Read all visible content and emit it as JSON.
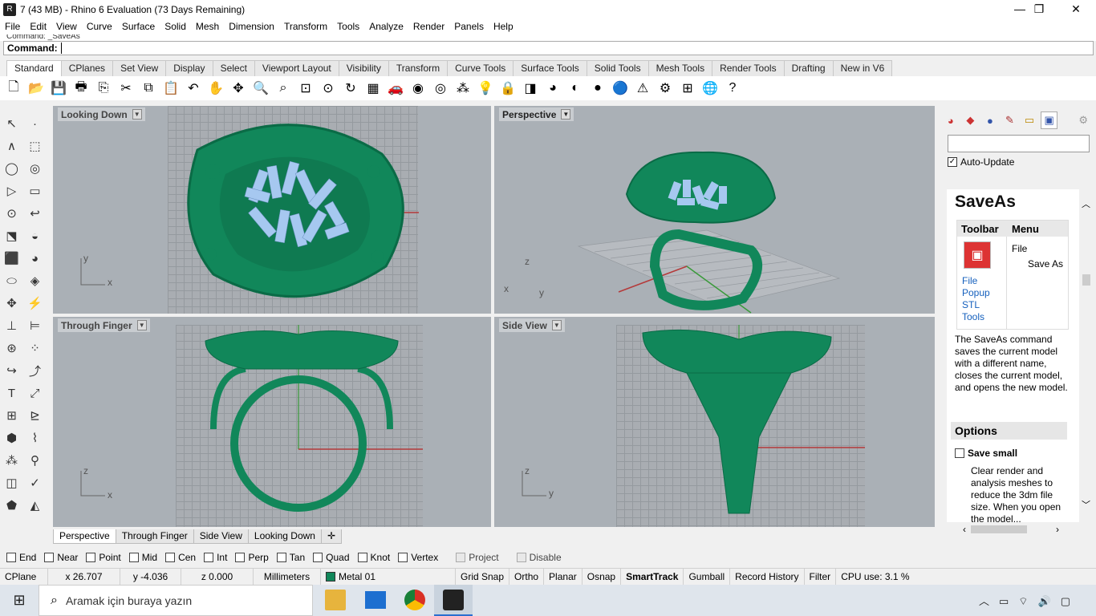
{
  "window": {
    "title": "7 (43 MB) - Rhino 6 Evaluation (73 Days Remaining)",
    "minimize": "—",
    "maximize": "❐",
    "close": "✕"
  },
  "menu": [
    "File",
    "Edit",
    "View",
    "Curve",
    "Surface",
    "Solid",
    "Mesh",
    "Dimension",
    "Transform",
    "Tools",
    "Analyze",
    "Render",
    "Panels",
    "Help"
  ],
  "command": {
    "history": "Command: _SaveAs",
    "label": "Command:"
  },
  "toolbar_tabs": [
    "Standard",
    "CPlanes",
    "Set View",
    "Display",
    "Select",
    "Viewport Layout",
    "Visibility",
    "Transform",
    "Curve Tools",
    "Surface Tools",
    "Solid Tools",
    "Mesh Tools",
    "Render Tools",
    "Drafting",
    "New in V6"
  ],
  "toolbar_icons": [
    "new-icon",
    "open-icon",
    "save-icon",
    "print-icon",
    "import-icon",
    "cut-icon",
    "copy-icon",
    "paste-icon",
    "undo-icon",
    "pan-icon",
    "rotate-icon",
    "zoom-icon",
    "zoom-window-icon",
    "zoom-extents-icon",
    "zoom-selected-icon",
    "zoom-dynamic-icon",
    "viewport-layout-icon",
    "car-icon",
    "camera-icon",
    "target-icon",
    "properties-icon",
    "light-icon",
    "lock-icon",
    "layer-icon",
    "color-wheel-icon",
    "shade-icon",
    "render-icon",
    "sphere-icon",
    "filter-icon",
    "options-icon",
    "grid-icon",
    "globe-icon",
    "help-icon"
  ],
  "toolbar_glyphs": [
    "🗋",
    "📂",
    "💾",
    "🖶",
    "⎘",
    "✂",
    "⧉",
    "📋",
    "↶",
    "✋",
    "✥",
    "🔍",
    "⌕",
    "⊡",
    "⊙",
    "↻",
    "▦",
    "🚗",
    "◉",
    "◎",
    "⁂",
    "💡",
    "🔒",
    "◨",
    "◕",
    "◐",
    "●",
    "🔵",
    "⚠",
    "⚙",
    "⊞",
    "🌐",
    "?"
  ],
  "viewports": [
    {
      "title": "Looking Down",
      "axes": [
        "y",
        "x"
      ]
    },
    {
      "title": "Perspective",
      "axes": [
        "z",
        "x",
        "y"
      ]
    },
    {
      "title": "Through Finger",
      "axes": [
        "z",
        "x"
      ]
    },
    {
      "title": "Side View",
      "axes": [
        "z",
        "y"
      ]
    }
  ],
  "viewport_tabs": [
    "Perspective",
    "Through Finger",
    "Side View",
    "Looking Down",
    "✛"
  ],
  "osnaps": [
    "End",
    "Near",
    "Point",
    "Mid",
    "Cen",
    "Int",
    "Perp",
    "Tan",
    "Quad",
    "Knot",
    "Vertex",
    "Project",
    "Disable"
  ],
  "status": {
    "cplane": "CPlane",
    "x": "x 26.707",
    "y": "y -4.036",
    "z": "z 0.000",
    "units": "Millimeters",
    "layer": "Metal 01",
    "gridsnap": "Grid Snap",
    "ortho": "Ortho",
    "planar": "Planar",
    "osnap": "Osnap",
    "smarttrack": "SmartTrack",
    "gumball": "Gumball",
    "history": "Record History",
    "filter": "Filter",
    "cpu": "CPU use: 3.1 %"
  },
  "help": {
    "autoupdate": "Auto-Update",
    "title": "SaveAs",
    "col1": "Toolbar",
    "col2": "Menu",
    "menu1": "File",
    "menu2": "Save As",
    "links": [
      "File",
      "Popup",
      "STL",
      "Tools"
    ],
    "desc": "The SaveAs command saves the current model with a different name, closes the current model, and opens the new model.",
    "options": "Options",
    "savesmall": "Save small",
    "savesmall_desc": "Clear render and analysis meshes to reduce the 3dm file size. When you open the model..."
  },
  "taskbar": {
    "search_placeholder": "Aramak için buraya yazın"
  },
  "colors": {
    "ring": "#11875a",
    "gems": "#a6c8f0",
    "viewport": "#aab0b6",
    "xaxis": "#b43a3a",
    "yaxis": "#3a9a3a"
  }
}
